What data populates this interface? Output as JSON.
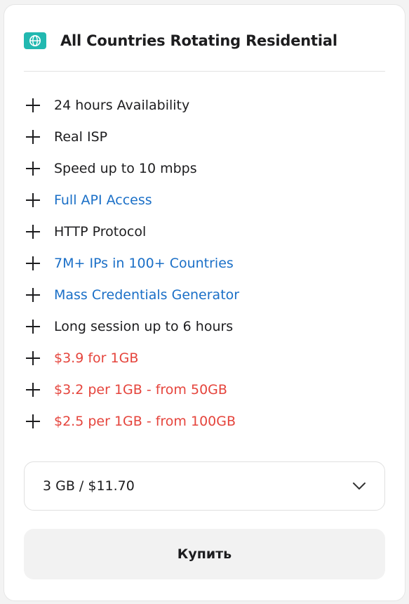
{
  "card": {
    "title": "All Countries Rotating Residential",
    "badge_icon": "globe-icon",
    "badge_color": "#22b8b0"
  },
  "features": [
    {
      "text": "24 hours Availability",
      "color": "default"
    },
    {
      "text": "Real ISP",
      "color": "default"
    },
    {
      "text": "Speed up to 10 mbps",
      "color": "default"
    },
    {
      "text": "Full API Access",
      "color": "blue"
    },
    {
      "text": "HTTP Protocol",
      "color": "default"
    },
    {
      "text": "7M+ IPs in 100+ Countries",
      "color": "blue"
    },
    {
      "text": "Mass Credentials Generator",
      "color": "blue"
    },
    {
      "text": "Long session up to 6 hours",
      "color": "default"
    },
    {
      "text": "$3.9 for 1GB",
      "color": "red"
    },
    {
      "text": "$3.2 per 1GB - from 50GB",
      "color": "red"
    },
    {
      "text": "$2.5 per 1GB - from 100GB",
      "color": "red"
    }
  ],
  "colors": {
    "default": "#1d1d1f",
    "blue": "#1a6fc7",
    "red": "#e5443c"
  },
  "plan_select": {
    "value": "3 GB / $11.70",
    "icon": "chevron-down-icon"
  },
  "buy_button": {
    "label": "Купить"
  }
}
